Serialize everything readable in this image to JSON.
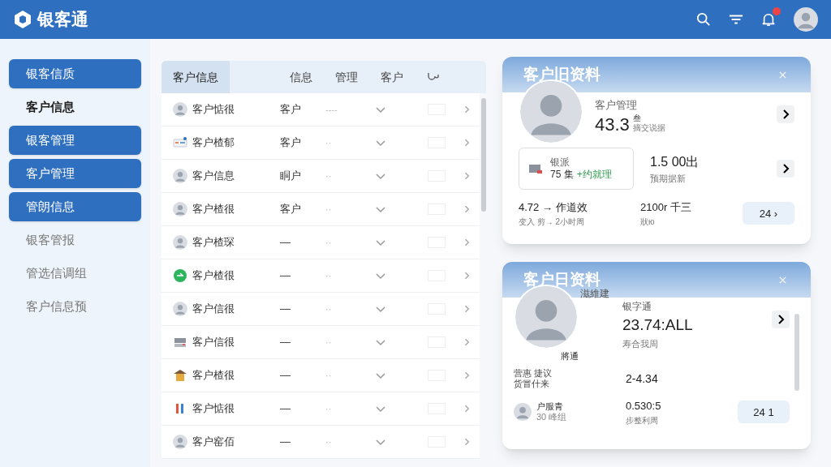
{
  "app": {
    "name": "银客通"
  },
  "sidebar": {
    "items": [
      {
        "label": "银客信质",
        "kind": "header"
      },
      {
        "label": "客户信息",
        "kind": "active"
      },
      {
        "label": "银客管理",
        "kind": "header"
      },
      {
        "label": "客户管理",
        "kind": "header"
      },
      {
        "label": "管朗信息",
        "kind": "header"
      },
      {
        "label": "银客管报",
        "kind": "plain"
      },
      {
        "label": "管选信调组",
        "kind": "plain"
      },
      {
        "label": "客户信息预",
        "kind": "plain"
      }
    ]
  },
  "table": {
    "tabs": [
      {
        "label": "客户信息",
        "selected": true
      },
      {
        "label": "信息",
        "selected": false
      },
      {
        "label": "管理",
        "selected": false
      },
      {
        "label": "客户",
        "selected": false
      }
    ],
    "rows": [
      {
        "kind": "avatar",
        "name": "客户惦很",
        "column_2": "客户",
        "column_3": "----"
      },
      {
        "kind": "card",
        "name": "客户楂郁",
        "column_2": "客户",
        "column_3": "··"
      },
      {
        "kind": "avatar",
        "name": "客户信息",
        "column_2": "眮户",
        "column_3": "··"
      },
      {
        "kind": "avatar",
        "name": "客户楂很",
        "column_2": "客户",
        "column_3": "··"
      },
      {
        "kind": "avatar",
        "name": "客户楂琛",
        "column_2": "—",
        "column_3": "··"
      },
      {
        "kind": "badge",
        "name": "客户楂很",
        "column_2": "—",
        "column_3": "··"
      },
      {
        "kind": "avatar",
        "name": "客户信很",
        "column_2": "—",
        "column_3": "··"
      },
      {
        "kind": "device",
        "name": "客户信很",
        "column_2": "—",
        "column_3": "··"
      },
      {
        "kind": "hut",
        "name": "客户楂很",
        "column_2": "—",
        "column_3": "··"
      },
      {
        "kind": "figures",
        "name": "客户惦很",
        "column_2": "—",
        "column_3": "··"
      },
      {
        "kind": "avatar",
        "name": "客户窑佰",
        "column_2": "—",
        "column_3": "··"
      }
    ]
  },
  "profile_cards": [
    {
      "title": "客户旧资料",
      "label": "客户管理",
      "value": "43.3",
      "unit": "叁",
      "caption": "摘交说据",
      "box": {
        "title": "银派",
        "count": "75 集",
        "tag": "+约就理"
      },
      "figure": "1.5 00出",
      "figure_caption": "预期据新",
      "stat_1": "4.72 → 作道效",
      "stat_1_caption": "变入 剪→ 2小时周",
      "stat_2": "2100r 千三",
      "stat_2_caption": "狀ю",
      "button": "24 ›"
    },
    {
      "title": "客户日资料",
      "subtitle": "滋維建",
      "photo_caption": "將通",
      "label": "银字通",
      "value": "23.74:ALL",
      "caption": "寿合我周",
      "stat_1": "营惠 捷议",
      "stat_1_caption": "货冒什来",
      "stat_2": "2-4.34",
      "person": {
        "name": "户服青",
        "detail": "30 峰组"
      },
      "figure": "0.530:5",
      "figure_caption": "步整利周",
      "button": "24 1"
    }
  ]
}
